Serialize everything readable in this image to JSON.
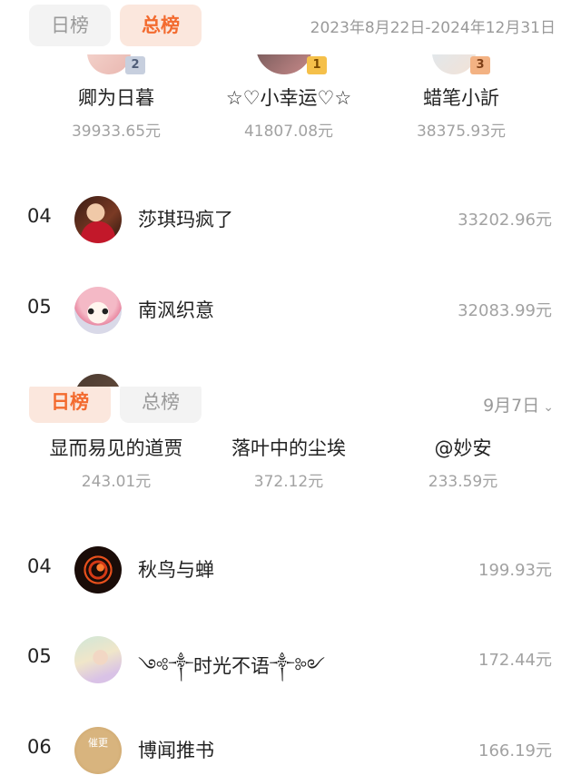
{
  "total_board": {
    "tabs": [
      {
        "label": "日榜",
        "active": false
      },
      {
        "label": "总榜",
        "active": true
      }
    ],
    "date_range": "2023年8月22日-2024年12月31日",
    "podium": [
      {
        "rank": "2",
        "name": "卿为日暮",
        "amount": "39933.65元"
      },
      {
        "rank": "1",
        "name": "☆♡小幸运♡☆",
        "amount": "41807.08元"
      },
      {
        "rank": "3",
        "name": "蜡笔小訢",
        "amount": "38375.93元"
      }
    ],
    "rows": [
      {
        "rank": "04",
        "name": "莎琪玛疯了",
        "amount": "33202.96元"
      },
      {
        "rank": "05",
        "name": "南沨织意",
        "amount": "32083.99元"
      }
    ]
  },
  "daily_board": {
    "tabs": [
      {
        "label": "日榜",
        "active": true
      },
      {
        "label": "总榜",
        "active": false
      }
    ],
    "date_label": "9月7日",
    "date_chevron_icon": "chevron-down-icon",
    "podium": [
      {
        "name": "显而易见的道贾",
        "amount": "243.01元"
      },
      {
        "name": "落叶中的尘埃",
        "amount": "372.12元"
      },
      {
        "name": "@妙安",
        "amount": "233.59元"
      }
    ],
    "rows": [
      {
        "rank": "04",
        "name": "秋鸟与蝉",
        "amount": "199.93元"
      },
      {
        "rank": "05",
        "name": "༺༒时光不语༒༻",
        "amount": "172.44元"
      },
      {
        "rank": "06",
        "name": "博闻推书",
        "amount": "166.19元",
        "avatar_text": "催更"
      }
    ]
  },
  "colors": {
    "accent": "#f36b2f",
    "active_tab_bg": "#fbe7dd",
    "inactive_tab_bg": "#f3f3f3",
    "muted_text": "#a2a2a2"
  }
}
